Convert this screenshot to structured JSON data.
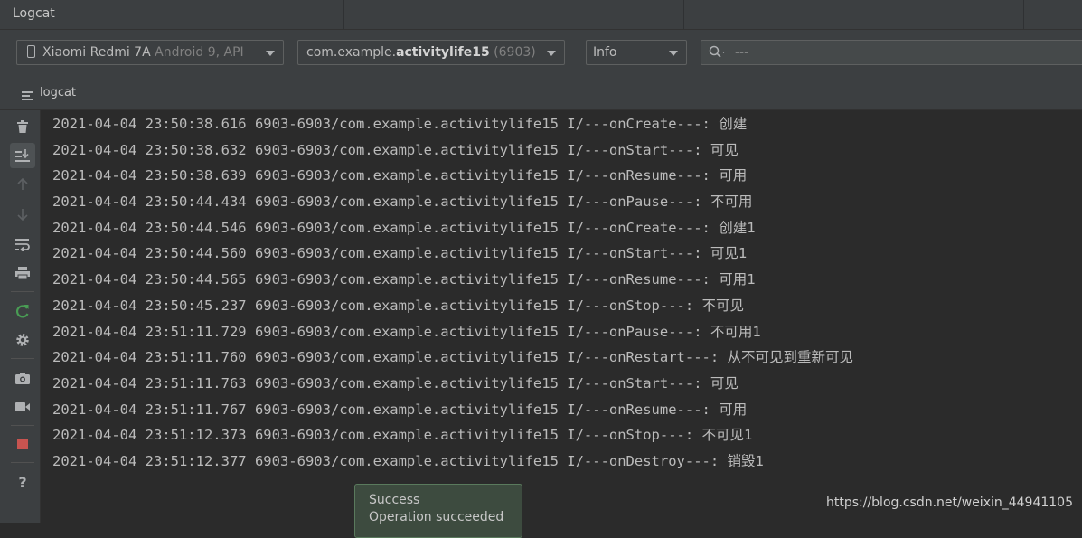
{
  "panel": {
    "title": "Logcat"
  },
  "device_select": {
    "name": "Xiaomi Redmi 7A",
    "detail": "Android 9, API"
  },
  "process_select": {
    "prefix": "com.example.",
    "package": "activitylife15",
    "pid": "(6903)"
  },
  "level_select": {
    "value": "Info"
  },
  "search": {
    "value": "---"
  },
  "subtoolbar": {
    "label": "logcat"
  },
  "sidebar_icons": [
    "trash-icon",
    "scroll-to-end-icon",
    "up-arrow-icon",
    "down-arrow-icon",
    "soft-wrap-icon",
    "print-icon",
    "restart-icon",
    "settings-icon",
    "screenshot-icon",
    "screen-record-icon",
    "stop-icon",
    "help-icon"
  ],
  "log_lines": [
    "2021-04-04 23:50:38.616 6903-6903/com.example.activitylife15 I/---onCreate---: 创建",
    "2021-04-04 23:50:38.632 6903-6903/com.example.activitylife15 I/---onStart---: 可见",
    "2021-04-04 23:50:38.639 6903-6903/com.example.activitylife15 I/---onResume---: 可用",
    "2021-04-04 23:50:44.434 6903-6903/com.example.activitylife15 I/---onPause---: 不可用",
    "2021-04-04 23:50:44.546 6903-6903/com.example.activitylife15 I/---onCreate---: 创建1",
    "2021-04-04 23:50:44.560 6903-6903/com.example.activitylife15 I/---onStart---: 可见1",
    "2021-04-04 23:50:44.565 6903-6903/com.example.activitylife15 I/---onResume---: 可用1",
    "2021-04-04 23:50:45.237 6903-6903/com.example.activitylife15 I/---onStop---: 不可见",
    "2021-04-04 23:51:11.729 6903-6903/com.example.activitylife15 I/---onPause---: 不可用1",
    "2021-04-04 23:51:11.760 6903-6903/com.example.activitylife15 I/---onRestart---: 从不可见到重新可见",
    "2021-04-04 23:51:11.763 6903-6903/com.example.activitylife15 I/---onStart---: 可见",
    "2021-04-04 23:51:11.767 6903-6903/com.example.activitylife15 I/---onResume---: 可用",
    "2021-04-04 23:51:12.373 6903-6903/com.example.activitylife15 I/---onStop---: 不可见1",
    "2021-04-04 23:51:12.377 6903-6903/com.example.activitylife15 I/---onDestroy---: 销毁1"
  ],
  "toast": {
    "title": "Success",
    "message": "Operation succeeded"
  },
  "watermark": "https://blog.csdn.net/weixin_44941105",
  "colors": {
    "background": "#2b2b2b",
    "panel": "#3c3f41",
    "text": "#bbbbbb",
    "stop_red": "#c75450",
    "restart_green": "#499c54"
  }
}
